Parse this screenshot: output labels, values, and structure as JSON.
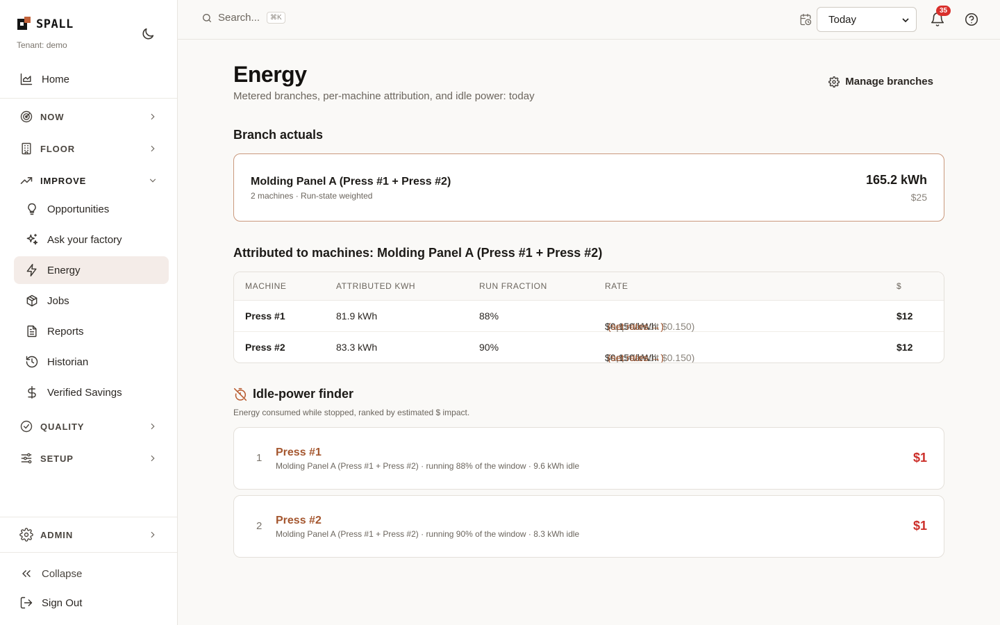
{
  "app": {
    "brand": "SPALL",
    "tenant": "Tenant: demo"
  },
  "sidebar": {
    "home": "Home",
    "groups": {
      "now": "NOW",
      "floor": "FLOOR",
      "improve": "IMPROVE",
      "quality": "QUALITY",
      "setup": "SETUP",
      "admin": "ADMIN"
    },
    "improve_items": [
      "Opportunities",
      "Ask your factory",
      "Energy",
      "Jobs",
      "Reports",
      "Historian",
      "Verified Savings"
    ],
    "active": "Energy",
    "collapse": "Collapse",
    "sign_out": "Sign Out"
  },
  "topbar": {
    "search_placeholder": "Search...",
    "shortcut": "⌘K",
    "date_range": "Today",
    "notifications": "35"
  },
  "page": {
    "title": "Energy",
    "subtitle": "Metered branches, per-machine attribution, and idle power: today",
    "manage_label": "Manage branches"
  },
  "branch_actuals": {
    "heading": "Branch actuals",
    "name": "Molding Panel A (Press #1 + Press #2)",
    "meta": "2 machines · Run-state weighted",
    "kwh": "165.2 kWh",
    "cost": "$25"
  },
  "attribution": {
    "heading": "Attributed to machines: Molding Panel A (Press #1 + Press #2)",
    "columns": [
      "MACHINE",
      "ATTRIBUTED KWH",
      "RUN FRACTION",
      "RATE",
      "$"
    ],
    "rows": [
      {
        "machine": "Press #1",
        "kwh": "81.9 kWh",
        "run": "88%",
        "rate": "$0.150/kWh",
        "default": "(app default $0.150)",
        "link": "(set rates →)",
        "cost": "$12"
      },
      {
        "machine": "Press #2",
        "kwh": "83.3 kWh",
        "run": "90%",
        "rate": "$0.150/kWh",
        "default": "(app default $0.150)",
        "link": "(set rates →)",
        "cost": "$12"
      }
    ]
  },
  "idle": {
    "heading": "Idle-power finder",
    "subtitle": "Energy consumed while stopped, ranked by estimated $ impact.",
    "items": [
      {
        "rank": "1",
        "name": "Press #1",
        "meta": "Molding Panel A (Press #1 + Press #2) · running 88% of the window · 9.6 kWh idle",
        "cost": "$1"
      },
      {
        "rank": "2",
        "name": "Press #2",
        "meta": "Molding Panel A (Press #1 + Press #2) · running 90% of the window · 8.3 kWh idle",
        "cost": "$1"
      }
    ]
  },
  "colors": {
    "accent": "#a4562e",
    "active_bg": "#f4ece8",
    "alert": "#cc2f2a"
  }
}
